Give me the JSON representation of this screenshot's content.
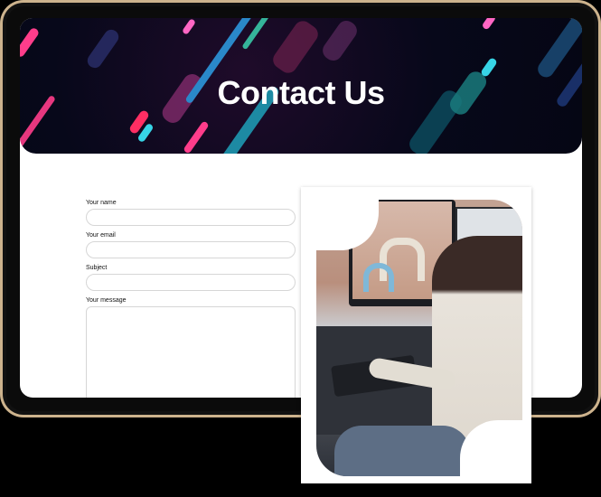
{
  "hero": {
    "title": "Contact Us"
  },
  "form": {
    "name_label": "Your name",
    "email_label": "Your email",
    "subject_label": "Subject",
    "message_label": "Your message"
  },
  "colors": {
    "frame_gold": "#cdb38d",
    "hero_dark": "#07081a",
    "streak_pink": "#ff3d8b",
    "streak_cyan": "#37d4e6"
  }
}
